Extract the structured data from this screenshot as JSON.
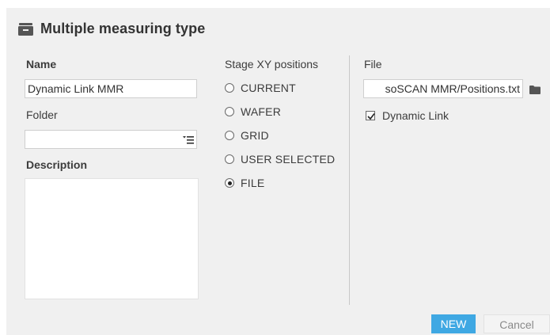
{
  "dialog": {
    "title": "Multiple measuring type",
    "icon": "tray-icon"
  },
  "form": {
    "name_label": "Name",
    "name_value": "Dynamic Link MMR",
    "folder_label": "Folder",
    "folder_value": "",
    "description_label": "Description",
    "description_value": ""
  },
  "stage": {
    "label": "Stage XY positions",
    "options": [
      {
        "label": "CURRENT",
        "checked": false
      },
      {
        "label": "WAFER",
        "checked": false
      },
      {
        "label": "GRID",
        "checked": false
      },
      {
        "label": "USER SELECTED",
        "checked": false
      },
      {
        "label": "FILE",
        "checked": true
      }
    ]
  },
  "file": {
    "label": "File",
    "value": "soSCAN MMR/Positions.txt",
    "dynamic_link_label": "Dynamic Link",
    "dynamic_link_checked": true
  },
  "buttons": {
    "new_label": "NEW",
    "cancel_label": "Cancel"
  },
  "colors": {
    "accent": "#3fa8e3",
    "panel_bg": "#f0f0f0"
  }
}
